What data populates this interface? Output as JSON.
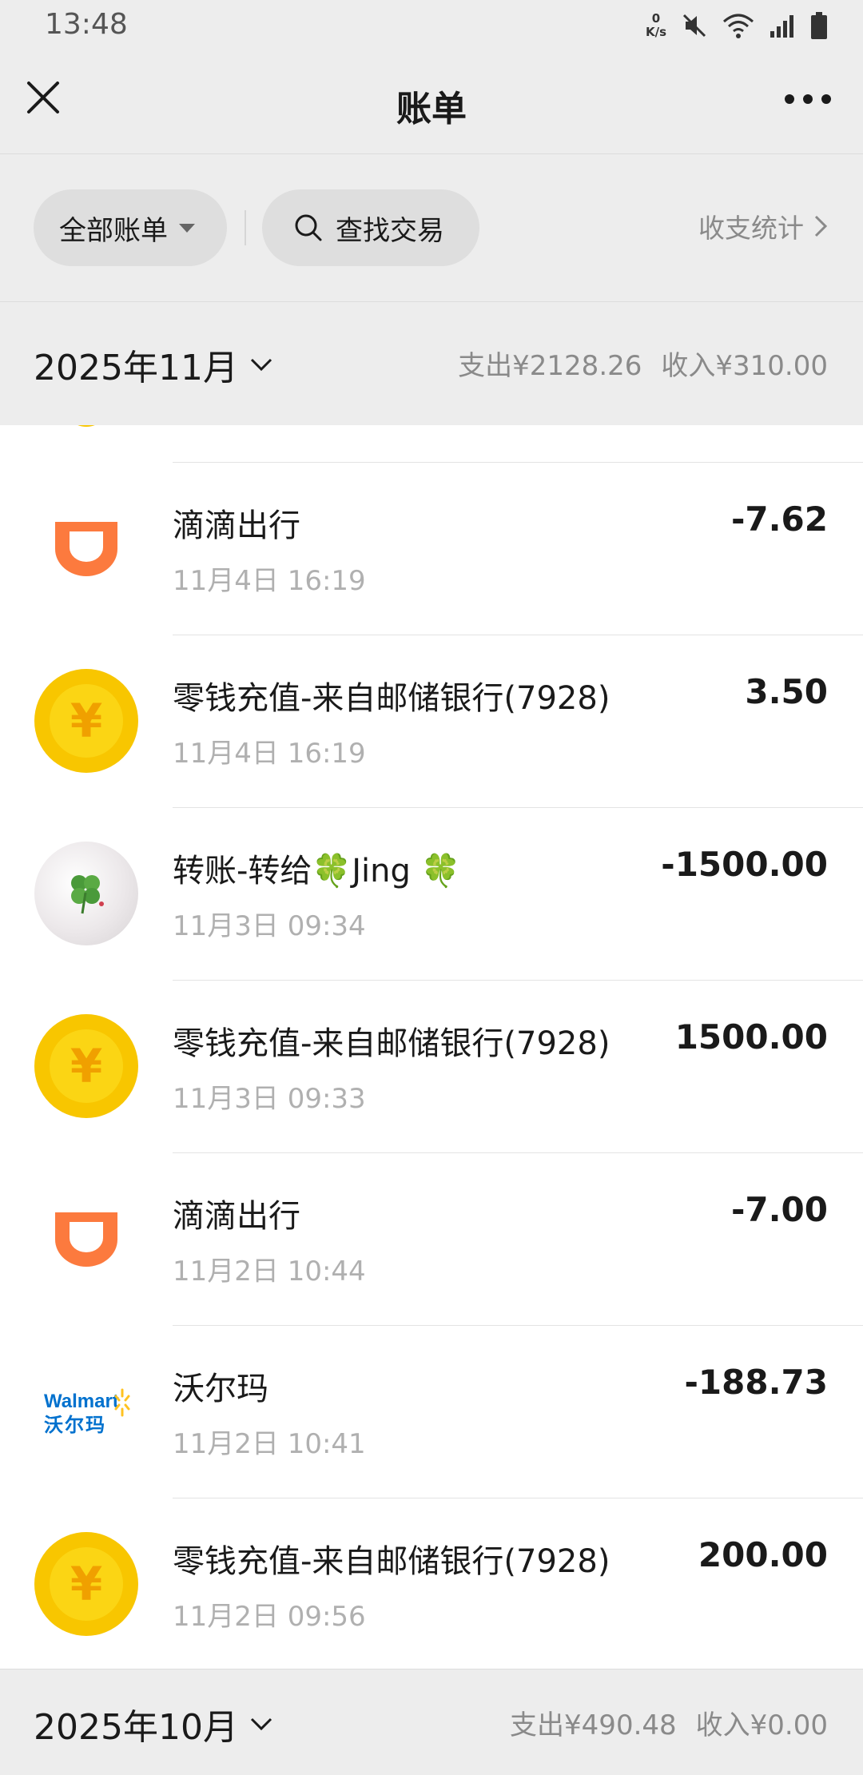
{
  "status_bar": {
    "time": "13:48",
    "net_speed_value": "0",
    "net_speed_unit": "K/s"
  },
  "header": {
    "title": "账单"
  },
  "filters": {
    "all_bills": "全部账单",
    "search": "查找交易",
    "stats": "收支统计"
  },
  "months": [
    {
      "label": "2025年11月",
      "expense": "支出¥2128.26",
      "income": "收入¥310.00"
    },
    {
      "label": "2025年10月",
      "expense": "支出¥490.48",
      "income": "收入¥0.00"
    }
  ],
  "transactions": [
    {
      "icon": "didi-icon",
      "name": "滴滴出行",
      "datetime": "11月4日 16:19",
      "amount": "-7.62"
    },
    {
      "icon": "yuan-coin-icon",
      "name": "零钱充值-来自邮储银行(7928)",
      "datetime": "11月4日 16:19",
      "amount": "3.50"
    },
    {
      "icon": "clover-photo-avatar",
      "name": "转账-转给🍀Jing 🍀",
      "datetime": "11月3日 09:34",
      "amount": "-1500.00"
    },
    {
      "icon": "yuan-coin-icon",
      "name": "零钱充值-来自邮储银行(7928)",
      "datetime": "11月3日 09:33",
      "amount": "1500.00"
    },
    {
      "icon": "didi-icon",
      "name": "滴滴出行",
      "datetime": "11月2日 10:44",
      "amount": "-7.00"
    },
    {
      "icon": "walmart-logo",
      "name": "沃尔玛",
      "datetime": "11月2日 10:41",
      "amount": "-188.73"
    },
    {
      "icon": "yuan-coin-icon",
      "name": "零钱充值-来自邮储银行(7928)",
      "datetime": "11月2日 09:56",
      "amount": "200.00"
    }
  ],
  "walmart_logo": {
    "text_en": "Walmart",
    "text_cn": "沃尔玛"
  },
  "coin_glyph": "¥",
  "colors": {
    "didi": "#fc7a3e",
    "coin": "#f8c600",
    "walmart_blue": "#0071ce",
    "walmart_spark": "#ffc220"
  }
}
